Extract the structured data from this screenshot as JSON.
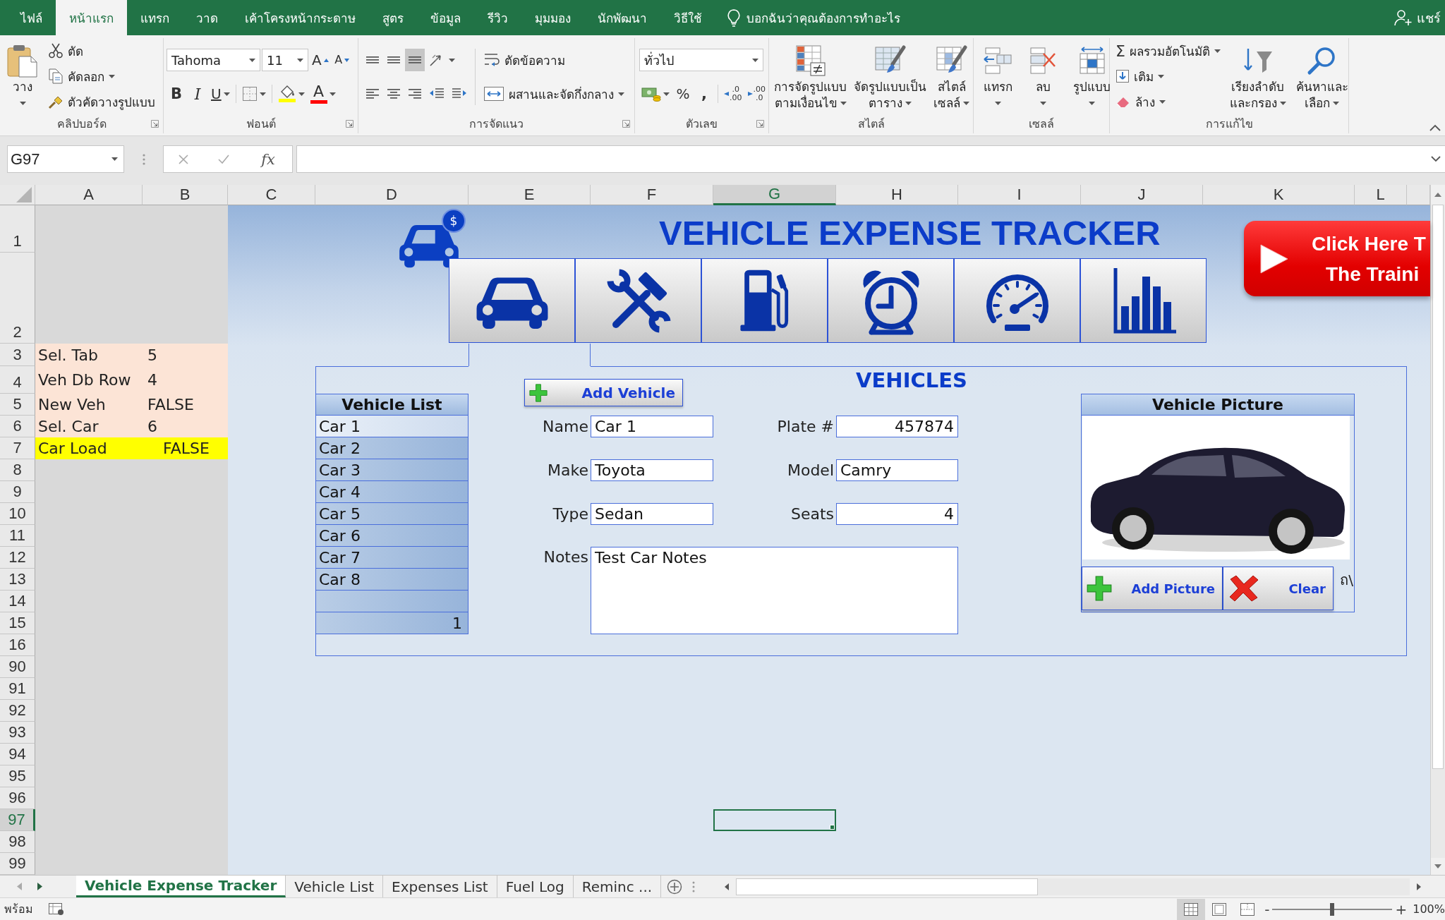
{
  "ribbon": {
    "tabs": [
      {
        "label": "ไฟล์",
        "selected": false
      },
      {
        "label": "หน้าแรก",
        "selected": true
      },
      {
        "label": "แทรก",
        "selected": false
      },
      {
        "label": "วาด",
        "selected": false
      },
      {
        "label": "เค้าโครงหน้ากระดาษ",
        "selected": false
      },
      {
        "label": "สูตร",
        "selected": false
      },
      {
        "label": "ข้อมูล",
        "selected": false
      },
      {
        "label": "รีวิว",
        "selected": false
      },
      {
        "label": "มุมมอง",
        "selected": false
      },
      {
        "label": "นักพัฒนา",
        "selected": false
      },
      {
        "label": "วิธีใช้",
        "selected": false
      }
    ],
    "tell_me": "บอกฉันว่าคุณต้องการทำอะไร",
    "share": "แชร์"
  },
  "clipboard": {
    "paste": "วาง",
    "cut": "ตัด",
    "copy": "คัดลอก",
    "format_painter": "ตัวคัดวางรูปแบบ",
    "label": "คลิปบอร์ด"
  },
  "font": {
    "name": "Tahoma",
    "size": "11",
    "grow": "A",
    "shrink": "A",
    "bold": "B",
    "italic": "I",
    "underline": "U",
    "font_color_letter": "A",
    "label": "ฟอนต์"
  },
  "alignment": {
    "vertical_align": [
      {
        "selected": false
      },
      {
        "selected": false
      },
      {
        "selected": true
      }
    ],
    "wrap_text": "ตัดข้อความ",
    "merge": "ผสานและจัดกึ่งกลาง",
    "label": "การจัดแนว"
  },
  "number": {
    "format": "ทั่วไป",
    "percent": "%",
    "comma": ",",
    "increase_decimal": [
      ".0",
      ".00"
    ],
    "decrease_decimal": [
      ".00",
      ".0"
    ],
    "label": "ตัวเลข"
  },
  "styles": {
    "buttons": [
      [
        "การจัดรูปแบบ",
        "ตามเงื่อนไข"
      ],
      [
        "จัดรูปแบบเป็น",
        "ตาราง"
      ],
      [
        "สไตล์",
        "เซลล์"
      ]
    ],
    "label": "สไตล์"
  },
  "cells": {
    "buttons": [
      "แทรก",
      "ลบ",
      "รูปแบบ"
    ],
    "label": "เซลล์"
  },
  "editing": {
    "autosum_symbol": "Σ",
    "autosum": "ผลรวมอัตโนมัติ",
    "fill": "เติม",
    "clear": "ล้าง",
    "buttons": [
      [
        "เรียงลำดับ",
        "และกรอง"
      ],
      [
        "ค้นหาและ",
        "เลือก"
      ]
    ],
    "label": "การแก้ไข"
  },
  "formula_bar": {
    "name_box": "G97",
    "function_label": "fx"
  },
  "columns": [
    {
      "label": "A",
      "selected": false
    },
    {
      "label": "B",
      "selected": false
    },
    {
      "label": "C",
      "selected": false
    },
    {
      "label": "D",
      "selected": false
    },
    {
      "label": "E",
      "selected": false
    },
    {
      "label": "F",
      "selected": false
    },
    {
      "label": "G",
      "selected": true
    },
    {
      "label": "H",
      "selected": false
    },
    {
      "label": "I",
      "selected": false
    },
    {
      "label": "J",
      "selected": false
    },
    {
      "label": "K",
      "selected": false
    },
    {
      "label": "L",
      "selected": false
    }
  ],
  "rows": [
    {
      "label": "1",
      "selected": false
    },
    {
      "label": "2",
      "selected": false
    },
    {
      "label": "3",
      "selected": false
    },
    {
      "label": "4",
      "selected": false
    },
    {
      "label": "5",
      "selected": false
    },
    {
      "label": "6",
      "selected": false
    },
    {
      "label": "7",
      "selected": false
    },
    {
      "label": "8",
      "selected": false
    },
    {
      "label": "9",
      "selected": false
    },
    {
      "label": "10",
      "selected": false
    },
    {
      "label": "11",
      "selected": false
    },
    {
      "label": "12",
      "selected": false
    },
    {
      "label": "13",
      "selected": false
    },
    {
      "label": "14",
      "selected": false
    },
    {
      "label": "15",
      "selected": false
    },
    {
      "label": "16",
      "selected": false
    },
    {
      "label": "90",
      "selected": false
    },
    {
      "label": "91",
      "selected": false
    },
    {
      "label": "92",
      "selected": false
    },
    {
      "label": "93",
      "selected": false
    },
    {
      "label": "94",
      "selected": false
    },
    {
      "label": "95",
      "selected": false
    },
    {
      "label": "96",
      "selected": false
    },
    {
      "label": "97",
      "selected": true
    },
    {
      "label": "98",
      "selected": false
    },
    {
      "label": "99",
      "selected": false
    }
  ],
  "settings": [
    {
      "label": "Sel. Tab",
      "value": "5",
      "highlighted": false
    },
    {
      "label": "Veh Db Row",
      "value": "4",
      "highlighted": false
    },
    {
      "label": "New Veh",
      "value": "FALSE",
      "highlighted": false
    },
    {
      "label": "Sel. Car",
      "value": "6",
      "highlighted": false
    },
    {
      "label": "Car Load",
      "value": "FALSE",
      "highlighted": true
    }
  ],
  "dashboard": {
    "logo_symbol": "$",
    "title": "VEHICLE EXPENSE TRACKER",
    "training_button": [
      "Click Here T",
      "The Traini"
    ]
  },
  "vehicle_list": {
    "title": "Vehicle List",
    "items": [
      {
        "label": "Car 1",
        "selected": true
      },
      {
        "label": "Car 2",
        "selected": false
      },
      {
        "label": "Car 3",
        "selected": false
      },
      {
        "label": "Car 4",
        "selected": false
      },
      {
        "label": "Car 5",
        "selected": false
      },
      {
        "label": "Car 6",
        "selected": false
      },
      {
        "label": "Car 7",
        "selected": false
      },
      {
        "label": "Car 8",
        "selected": false
      }
    ],
    "count": "1"
  },
  "vehicle_form": {
    "title": "VEHICLES",
    "add_button": "Add Vehicle",
    "fields": [
      {
        "label": "Name",
        "value": "Car 1",
        "kind": "text"
      },
      {
        "label": "Plate #",
        "value": "457874",
        "kind": "number"
      },
      {
        "label": "Make",
        "value": "Toyota",
        "kind": "text"
      },
      {
        "label": "Model",
        "value": "Camry",
        "kind": "text"
      },
      {
        "label": "Type",
        "value": "Sedan",
        "kind": "text"
      },
      {
        "label": "Seats",
        "value": "4",
        "kind": "number"
      }
    ],
    "notes": {
      "label": "Notes",
      "value": "Test Car Notes"
    }
  },
  "vehicle_picture": {
    "title": "Vehicle Picture",
    "add_button": "Add Picture",
    "clear_button": "Clear",
    "cell_text": "ถ\\"
  },
  "sheet_tabs": [
    {
      "label": "Vehicle Expense Tracker",
      "selected": true
    },
    {
      "label": "Vehicle List",
      "selected": false
    },
    {
      "label": "Expenses List",
      "selected": false
    },
    {
      "label": "Fuel Log",
      "selected": false
    },
    {
      "label": "Reminc ...",
      "selected": false
    }
  ],
  "status_bar": {
    "mode": "พร้อม",
    "views": [
      {
        "selected": true
      },
      {
        "selected": false
      },
      {
        "selected": false
      }
    ],
    "zoom_out": "-",
    "zoom_in": "+",
    "zoom": {
      "level": 0.5,
      "reading": "100%"
    }
  }
}
